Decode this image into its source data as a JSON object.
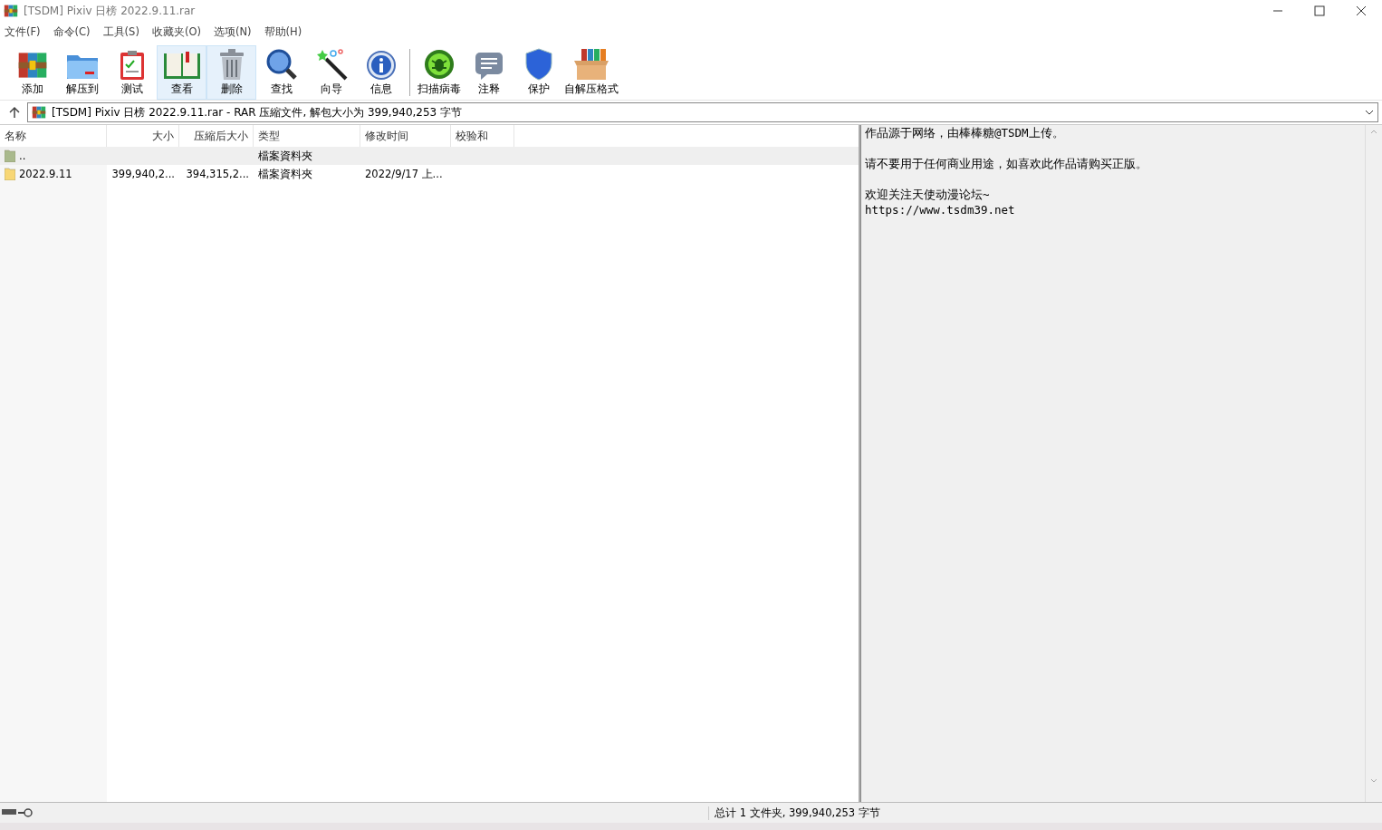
{
  "window": {
    "title": "[TSDM] Pixiv 日榜 2022.9.11.rar"
  },
  "menu": [
    "文件(F)",
    "命令(C)",
    "工具(S)",
    "收藏夹(O)",
    "选项(N)",
    "帮助(H)"
  ],
  "toolbar": [
    {
      "label": "添加",
      "highlighted": false
    },
    {
      "label": "解压到",
      "highlighted": false
    },
    {
      "label": "测试",
      "highlighted": false
    },
    {
      "label": "查看",
      "highlighted": true
    },
    {
      "label": "删除",
      "highlighted": true
    },
    {
      "label": "查找",
      "highlighted": false
    },
    {
      "label": "向导",
      "highlighted": false
    },
    {
      "label": "信息",
      "highlighted": false
    },
    {
      "label": "扫描病毒",
      "highlighted": false
    },
    {
      "label": "注释",
      "highlighted": false
    },
    {
      "label": "保护",
      "highlighted": false
    },
    {
      "label": "自解压格式",
      "highlighted": false
    }
  ],
  "address": "[TSDM] Pixiv 日榜 2022.9.11.rar - RAR 压縮文件, 解包大小为 399,940,253 字节",
  "table": {
    "columns": [
      "名称",
      "大小",
      "压縮后大小",
      "类型",
      "修改时间",
      "校验和"
    ],
    "rows": [
      {
        "kind": "parent",
        "selected": true,
        "cells": [
          "..",
          "",
          "",
          "檔案資料夾",
          "",
          ""
        ]
      },
      {
        "kind": "folder",
        "selected": false,
        "cells": [
          "2022.9.11",
          "399,940,2...",
          "394,315,2...",
          "檔案資料夾",
          "2022/9/17 上...",
          ""
        ]
      }
    ]
  },
  "comment": [
    {
      "lines": [
        "作品源于网络，由棒棒糖@TSDM上传。"
      ]
    },
    {
      "lines": [
        "请不要用于任何商业用途，如喜欢此作品请购买正版。"
      ]
    },
    {
      "lines": [
        "欢迎关注天使动漫论坛~",
        "https://www.tsdm39.net"
      ]
    }
  ],
  "status_bar": "总计 1 文件夹, 399,940,253 字节"
}
